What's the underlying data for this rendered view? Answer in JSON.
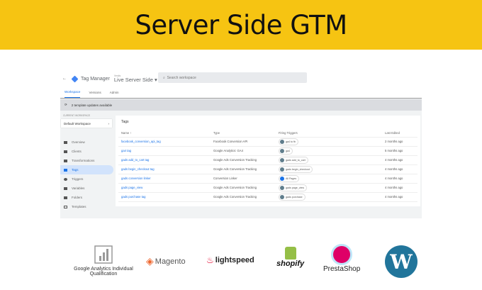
{
  "banner": {
    "title": "Server Side GTM"
  },
  "gtm": {
    "app_name": "Tag Manager",
    "account_label": "Vestis",
    "container": "Live Server Side",
    "search_placeholder": "Search workspace",
    "tabs": [
      "Workspace",
      "Versions",
      "Admin"
    ],
    "notice": "2 template updates available",
    "current_workspace_label": "CURRENT WORKSPACE",
    "workspace": "Default Workspace",
    "nav": [
      "Overview",
      "Clients",
      "Transformations",
      "Tags",
      "Triggers",
      "Variables",
      "Folders",
      "Templates"
    ],
    "card_title": "Tags",
    "columns": [
      "Name ↑",
      "Type",
      "Firing Triggers",
      "Last Edited"
    ],
    "rows": [
      {
        "name": "facebook_conversion_api_tag",
        "type": "Facebook Conversion API",
        "trigger": "ga4 to fb",
        "edited": "2 months ago"
      },
      {
        "name": "ga4 tag",
        "type": "Google Analytics: GA4",
        "trigger": "ga4",
        "edited": "5 months ago"
      },
      {
        "name": "gads add_to_cart tag",
        "type": "Google Ads Conversion Tracking",
        "trigger": "gads add_to_cart",
        "edited": "4 months ago"
      },
      {
        "name": "gads begin_checkout tag",
        "type": "Google Ads Conversion Tracking",
        "trigger": "gads begin_checkout",
        "edited": "4 months ago"
      },
      {
        "name": "gads conversion linker",
        "type": "Conversion Linker",
        "trigger": "All Pages",
        "edited": "4 months ago"
      },
      {
        "name": "gads page_view",
        "type": "Google Ads Conversion Tracking",
        "trigger": "gads page_view",
        "edited": "4 months ago"
      },
      {
        "name": "gads purchase tag",
        "type": "Google Ads Conversion Tracking",
        "trigger": "gads purchase",
        "edited": "4 months ago"
      }
    ]
  },
  "logos": {
    "ga": "Google Analytics Individual Qualification",
    "magento": "Magento",
    "lightspeed": "lightspeed",
    "shopify": "shopify",
    "prestashop": "PrestaShop",
    "wordpress": "W"
  },
  "colors": {
    "banner": "#f6c412",
    "link": "#1a73e8"
  }
}
